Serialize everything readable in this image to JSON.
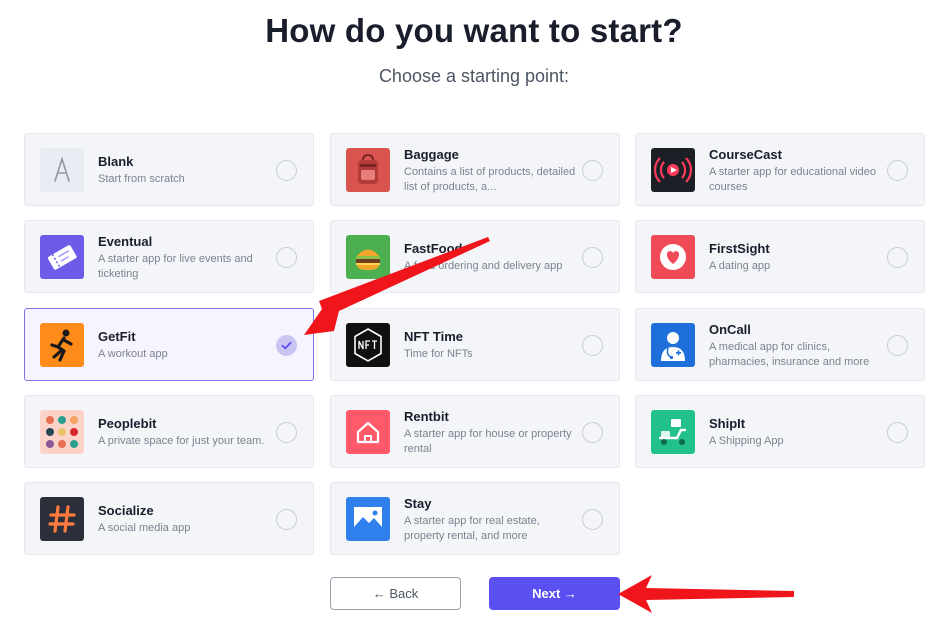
{
  "header": {
    "title": "How do you want to start?",
    "subtitle": "Choose a starting point:"
  },
  "templates": [
    {
      "name": "Blank",
      "desc": "Start from scratch",
      "icon": "blank-a-icon",
      "selected": false
    },
    {
      "name": "Baggage",
      "desc": "Contains a list of products, detailed list of products, a...",
      "icon": "backpack-icon",
      "selected": false
    },
    {
      "name": "CourseCast",
      "desc": "A starter app for educational video courses",
      "icon": "broadcast-play-icon",
      "selected": false
    },
    {
      "name": "Eventual",
      "desc": "A starter app for live events and ticketing",
      "icon": "ticket-icon",
      "selected": false
    },
    {
      "name": "FastFood",
      "desc": "A food ordering and delivery app",
      "icon": "burger-icon",
      "selected": false
    },
    {
      "name": "FirstSight",
      "desc": "A dating app",
      "icon": "heart-icon",
      "selected": false
    },
    {
      "name": "GetFit",
      "desc": "A workout app",
      "icon": "runner-icon",
      "selected": true
    },
    {
      "name": "NFT Time",
      "desc": "Time for NFTs",
      "icon": "nft-badge-icon",
      "selected": false
    },
    {
      "name": "OnCall",
      "desc": "A medical app for clinics, pharmacies, insurance and more",
      "icon": "doctor-icon",
      "selected": false
    },
    {
      "name": "Peoplebit",
      "desc": "A private space for just your team.",
      "icon": "people-grid-icon",
      "selected": false
    },
    {
      "name": "Rentbit",
      "desc": "A starter app for house or property rental",
      "icon": "house-icon",
      "selected": false
    },
    {
      "name": "ShipIt",
      "desc": "A Shipping App",
      "icon": "delivery-scooter-icon",
      "selected": false
    },
    {
      "name": "Socialize",
      "desc": "A social media app",
      "icon": "hashtag-icon",
      "selected": false
    },
    {
      "name": "Stay",
      "desc": "A starter app for real estate, property rental, and more",
      "icon": "mountain-image-icon",
      "selected": false
    }
  ],
  "actions": {
    "back_label": "← Back",
    "next_label": "Next →"
  },
  "colors": {
    "accent": "#5a4ff0",
    "selected_border": "#7c73e6",
    "annotation_arrow": "#f0141b"
  }
}
